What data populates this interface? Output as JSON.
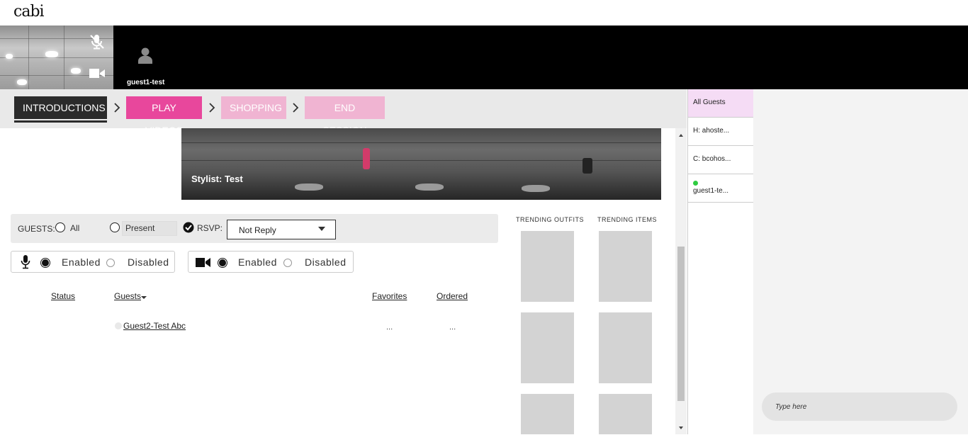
{
  "app": {
    "logo": "cabi"
  },
  "video_strip": {
    "guest_name": "guest1-test"
  },
  "steps": [
    {
      "label": "INTRODUCTIONS"
    },
    {
      "label": "PLAY VIDEOS"
    },
    {
      "label": "SHOPPING"
    },
    {
      "label": "END SESSION"
    }
  ],
  "stage": {
    "stylist_label": "Stylist: Test"
  },
  "filters": {
    "guests_label": "GUESTS:",
    "all_label": "All",
    "present_label": "Present",
    "rsvp_label": "RSVP:",
    "rsvp_value": "Not Reply"
  },
  "audio_toggle": {
    "enabled_label": "Enabled",
    "disabled_label": "Disabled"
  },
  "video_toggle": {
    "enabled_label": "Enabled",
    "disabled_label": "Disabled"
  },
  "table": {
    "headers": {
      "status": "Status",
      "guests": "Guests",
      "favorites": "Favorites",
      "ordered": "Ordered"
    },
    "rows": [
      {
        "guest": "Guest2-Test Abc",
        "favorites": "...",
        "ordered": "..."
      }
    ]
  },
  "trending": {
    "outfits_title": "TRENDING OUTFITS",
    "items_title": "TRENDING ITEMS"
  },
  "guest_list": {
    "items": [
      {
        "label": "All Guests"
      },
      {
        "label": "H: ahoste..."
      },
      {
        "label": "C: bcohos..."
      },
      {
        "label": "guest1-te...",
        "online": true
      }
    ]
  },
  "chat": {
    "placeholder": "Type here"
  },
  "colors": {
    "accent": "#e8479c",
    "accent_light": "#f0b4d2",
    "dark": "#2b2b2b",
    "online": "#2ecc40",
    "selected_list": "#f5dcf5"
  }
}
